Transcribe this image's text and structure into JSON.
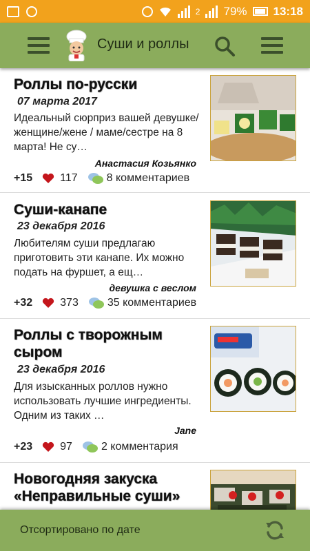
{
  "status_bar": {
    "battery": "79%",
    "time": "13:18",
    "sim_indicator": "2"
  },
  "toolbar": {
    "title": "Суши и роллы",
    "left_menu_icon": "hamburger-icon",
    "search_icon": "search-icon",
    "right_menu_icon": "hamburger-icon",
    "logo_icon": "chef-icon"
  },
  "articles": [
    {
      "title": "Роллы по-русски",
      "date": "07 марта 2017",
      "description": "Идеальный сюрприз вашей девушке/женщине/жене / маме/сестре на 8 марта! Не су…",
      "author": "Анастасия Козьянко",
      "score": "+15",
      "likes": "117",
      "comments": "8 комментариев"
    },
    {
      "title": "Суши-канапе",
      "date": "23 декабря 2016",
      "description": "Любителям суши предлагаю приготовить эти канапе. Их можно подать на фуршет, а ещ…",
      "author": "девушка с веслом",
      "score": "+32",
      "likes": "373",
      "comments": "35 комментариев"
    },
    {
      "title": "Роллы с творожным сыром",
      "date": "23 декабря 2016",
      "description": "Для изысканных роллов нужно использовать лучшие ингредиенты. Одним из таких …",
      "author": "Jane",
      "score": "+23",
      "likes": "97",
      "comments": "2 комментария"
    },
    {
      "title": "Новогодняя закуска «Неправильные суши»",
      "date": "",
      "description": "",
      "author": "",
      "score": "",
      "likes": "",
      "comments": ""
    }
  ],
  "bottom_bar": {
    "sort_label": "Отсортировано по дате",
    "refresh_icon": "refresh-icon"
  },
  "colors": {
    "status_bar": "#f2a21c",
    "toolbar": "#8bac5c",
    "heart": "#c4161c",
    "thumb_border": "#c9a23a"
  }
}
